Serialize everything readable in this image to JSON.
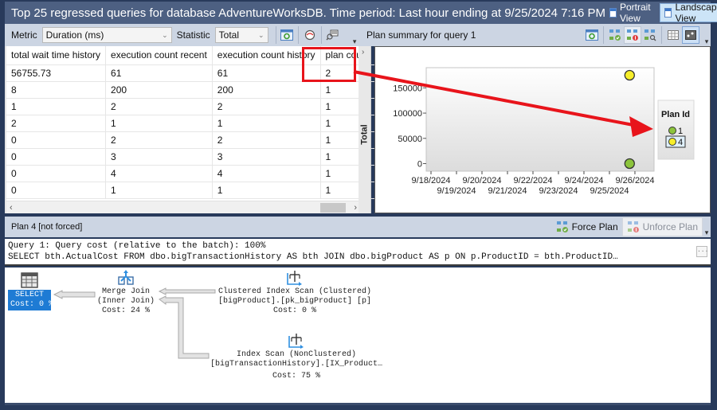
{
  "window": {
    "title": "Top 25 regressed queries for database AdventureWorksDB. Time period: Last hour ending at 9/25/2024 7:16 PM",
    "views": [
      {
        "label": "Portrait View",
        "active": false,
        "icon": "portrait-view-icon"
      },
      {
        "label": "Landscape View",
        "active": true,
        "icon": "landscape-view-icon"
      }
    ]
  },
  "left_toolbar": {
    "metric_label": "Metric",
    "metric_value": "Duration (ms)",
    "statistic_label": "Statistic",
    "statistic_value": "Total",
    "icons": [
      "refresh-icon",
      "track-query-icon",
      "view-query-text-icon"
    ]
  },
  "grid": {
    "columns": [
      "total wait time history",
      "execution count recent",
      "execution count history",
      "plan count"
    ],
    "rows": [
      [
        "56755.73",
        "61",
        "61",
        "2"
      ],
      [
        "8",
        "200",
        "200",
        "1"
      ],
      [
        "1",
        "2",
        "2",
        "1"
      ],
      [
        "2",
        "1",
        "1",
        "1"
      ],
      [
        "0",
        "2",
        "2",
        "1"
      ],
      [
        "0",
        "3",
        "3",
        "1"
      ],
      [
        "0",
        "4",
        "4",
        "1"
      ],
      [
        "0",
        "1",
        "1",
        "1"
      ]
    ],
    "highlighted_cell": {
      "column": "plan count",
      "row": 0
    }
  },
  "right_toolbar": {
    "title": "Plan summary for query 1",
    "icons": [
      "refresh-icon",
      "force-plan-icon",
      "unforce-plan-icon",
      "compare-plans-icon",
      "grid-view-icon",
      "chart-view-icon"
    ]
  },
  "chart_data": {
    "type": "scatter",
    "title": "",
    "xlabel": "",
    "ylabel": "Total",
    "x_ticks_top": [
      "9/18/2024",
      "9/20/2024",
      "9/22/2024",
      "9/24/2024",
      "9/26/2024"
    ],
    "x_ticks_bottom": [
      "9/19/2024",
      "9/21/2024",
      "9/23/2024",
      "9/25/2024"
    ],
    "x_range_days": [
      "9/18/2024",
      "9/26/2024"
    ],
    "y_ticks": [
      0,
      50000,
      100000,
      150000
    ],
    "ylim": [
      -15000,
      190000
    ],
    "legend_title": "Plan Id",
    "legend_position": "right",
    "series": [
      {
        "name": "1",
        "color": "#8cc43c",
        "points": [
          {
            "x": "9/25/2024 19:00",
            "y": 0
          }
        ]
      },
      {
        "name": "4",
        "color": "#f7ee2a",
        "points": [
          {
            "x": "9/25/2024 19:00",
            "y": 175000
          }
        ]
      }
    ]
  },
  "plan_bar": {
    "title": "Plan 4 [not forced]",
    "force_label": "Force Plan",
    "unforce_label": "Unforce Plan"
  },
  "query": {
    "line1": "Query 1: Query cost (relative to the batch): 100%",
    "line2": "SELECT bth.ActualCost FROM dbo.bigTransactionHistory AS bth JOIN dbo.bigProduct AS p ON p.ProductID = bth.ProductID…",
    "expand_label": "..."
  },
  "plan": {
    "select": {
      "line1": "SELECT",
      "line2": "Cost: 0 %"
    },
    "merge_join": {
      "line1": "Merge Join",
      "line2": "(Inner Join)",
      "line3": "Cost: 24 %"
    },
    "clustered_scan": {
      "line1": "Clustered Index Scan (Clustered)",
      "line2": "[bigProduct].[pk_bigProduct] [p]",
      "line3": "Cost: 0 %"
    },
    "index_scan": {
      "line1": "Index Scan (NonClustered)",
      "line2": "[bigTransactionHistory].[IX_Product…",
      "line3": "Cost: 75 %"
    }
  },
  "colors": {
    "title_bar": "#4d6082",
    "toolbar": "#ccd5e3",
    "highlight_annotation": "#e8141b",
    "select_node": "#1e7bd4"
  }
}
